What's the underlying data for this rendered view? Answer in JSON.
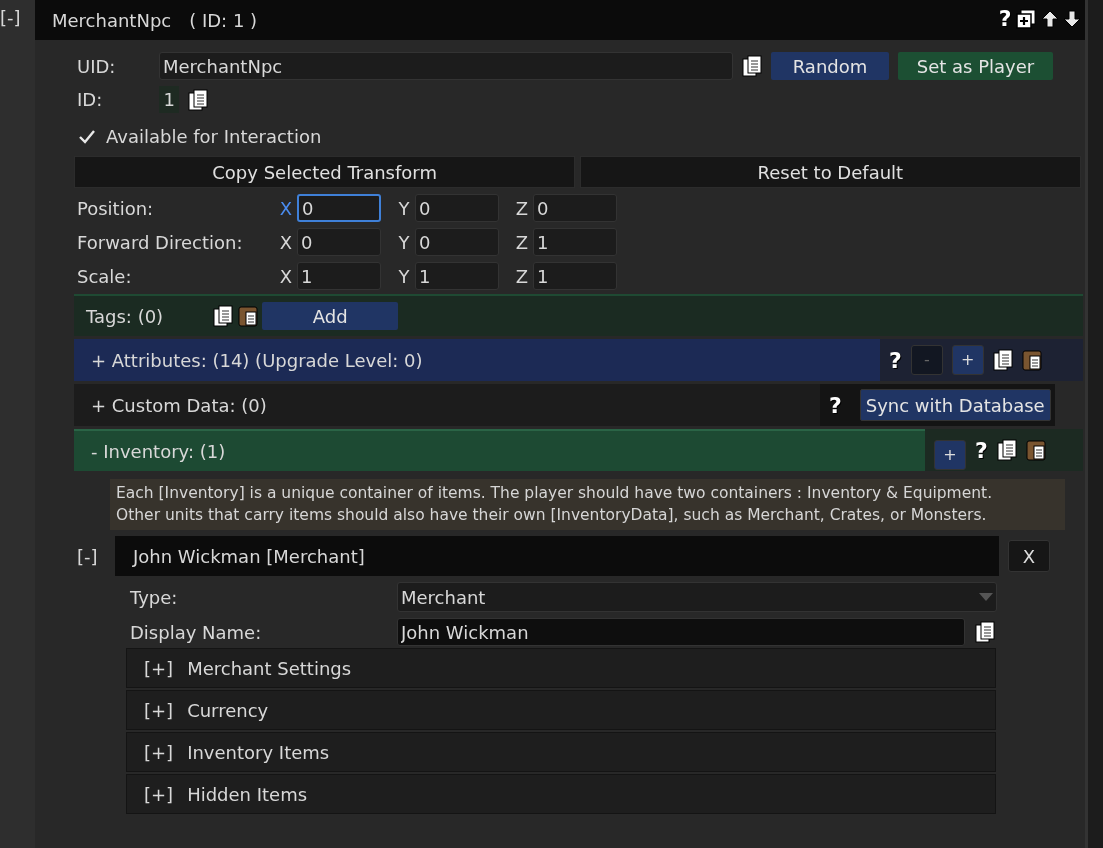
{
  "header": {
    "toggle": "[-]",
    "title": "MerchantNpc",
    "id_text": "( ID: 1 )",
    "help": "?"
  },
  "uid": {
    "label": "UID:",
    "value": "MerchantNpc",
    "buttons": [
      {
        "label": "Random",
        "kind": "blue"
      },
      {
        "label": "Set as Player",
        "kind": "green"
      }
    ]
  },
  "id": {
    "label": "ID:",
    "value": "1"
  },
  "interaction": {
    "label": "Available for Interaction",
    "checked": true
  },
  "transform_buttons": [
    "Copy Selected Transform",
    "Reset to Default"
  ],
  "transform_rows": [
    {
      "label": "Position:",
      "fields": [
        {
          "axis": "X",
          "value": "0",
          "focused": true
        },
        {
          "axis": "Y",
          "value": "0",
          "focused": false
        },
        {
          "axis": "Z",
          "value": "0",
          "focused": false
        }
      ]
    },
    {
      "label": "Forward Direction:",
      "fields": [
        {
          "axis": "X",
          "value": "0",
          "focused": false
        },
        {
          "axis": "Y",
          "value": "0",
          "focused": false
        },
        {
          "axis": "Z",
          "value": "1",
          "focused": false
        }
      ]
    },
    {
      "label": "Scale:",
      "fields": [
        {
          "axis": "X",
          "value": "1",
          "focused": false
        },
        {
          "axis": "Y",
          "value": "1",
          "focused": false
        },
        {
          "axis": "Z",
          "value": "1",
          "focused": false
        }
      ]
    }
  ],
  "tags": {
    "label": "Tags: (0)",
    "button": "Add"
  },
  "attributes": {
    "label": "+ Attributes: (14) (Upgrade Level: 0)",
    "help": "?",
    "minus": "-",
    "plus": "+"
  },
  "custom_data": {
    "label": "+ Custom Data: (0)",
    "help": "?",
    "button": "Sync with Database"
  },
  "inventory": {
    "label": "- Inventory: (1)",
    "plus": "+",
    "help": "?",
    "description": "Each [Inventory] is a unique container of items. The player should have two containers : Inventory & Equipment. Other units that carry items should also have their own [InventoryData], such as Merchant, Crates, or Monsters.",
    "items": [
      {
        "toggle": "[-]",
        "title": "John Wickman [Merchant]",
        "remove": "X",
        "type_label": "Type:",
        "type_value": "Merchant",
        "name_label": "Display Name:",
        "name_value": "John Wickman",
        "subsections": [
          {
            "toggle": "[+]",
            "label": "Merchant Settings"
          },
          {
            "toggle": "[+]",
            "label": "Currency"
          },
          {
            "toggle": "[+]",
            "label": "Inventory Items"
          },
          {
            "toggle": "[+]",
            "label": "Hidden Items"
          }
        ]
      }
    ]
  }
}
